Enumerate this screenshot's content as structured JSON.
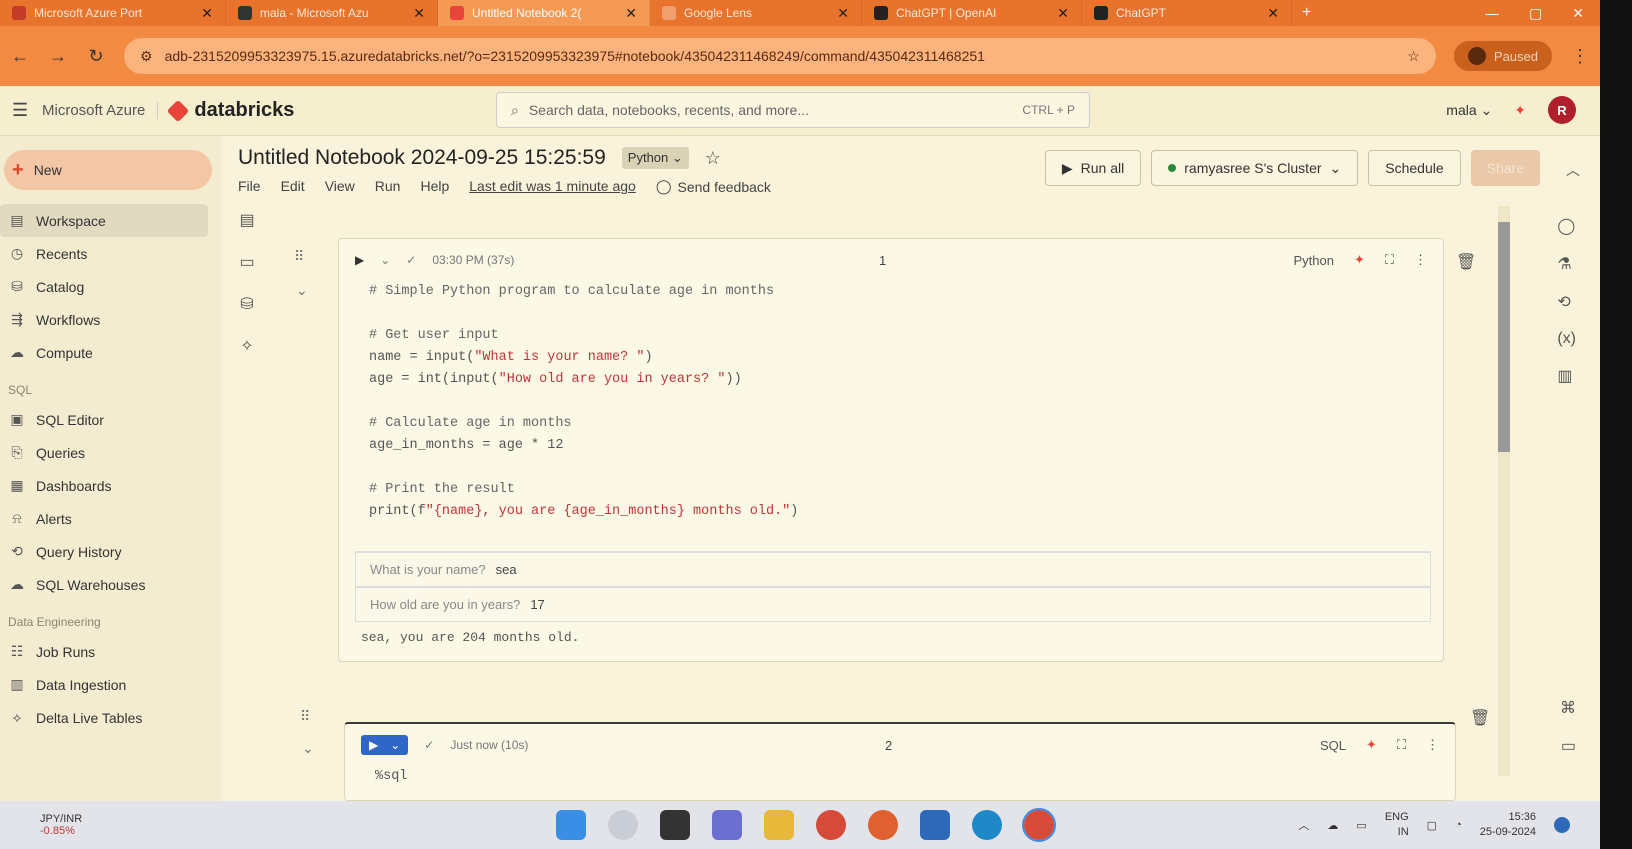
{
  "browser": {
    "tabs": [
      {
        "label": "Microsoft Azure Port",
        "active": false
      },
      {
        "label": "mala - Microsoft Azu",
        "active": false
      },
      {
        "label": "Untitled Notebook 2(",
        "active": true
      },
      {
        "label": "Google Lens",
        "active": false
      },
      {
        "label": "ChatGPT | OpenAI",
        "active": false
      },
      {
        "label": "ChatGPT",
        "active": false
      }
    ],
    "url": "adb-2315209953323975.15.azuredatabricks.net/?o=2315209953323975#notebook/435042311468249/command/435042311468251",
    "paused_label": "Paused"
  },
  "header": {
    "azure_label": "Microsoft Azure",
    "brand": "databricks",
    "search_placeholder": "Search data, notebooks, recents, and more...",
    "search_shortcut": "CTRL + P",
    "user_menu": "mala",
    "avatar_initial": "R"
  },
  "sidebar": {
    "new_label": "New",
    "items": [
      {
        "label": "Workspace",
        "icon": "folder-icon"
      },
      {
        "label": "Recents",
        "icon": "clock-icon"
      },
      {
        "label": "Catalog",
        "icon": "catalog-icon"
      },
      {
        "label": "Workflows",
        "icon": "workflow-icon"
      },
      {
        "label": "Compute",
        "icon": "cloud-icon"
      }
    ],
    "sql_section": "SQL",
    "sql_items": [
      {
        "label": "SQL Editor"
      },
      {
        "label": "Queries"
      },
      {
        "label": "Dashboards"
      },
      {
        "label": "Alerts"
      },
      {
        "label": "Query History"
      },
      {
        "label": "SQL Warehouses"
      }
    ],
    "de_section": "Data Engineering",
    "de_items": [
      {
        "label": "Job Runs"
      },
      {
        "label": "Data Ingestion"
      },
      {
        "label": "Delta Live Tables"
      }
    ]
  },
  "notebook": {
    "title": "Untitled Notebook 2024-09-25 15:25:59",
    "language": "Python",
    "menu": [
      "File",
      "Edit",
      "View",
      "Run",
      "Help"
    ],
    "last_edit": "Last edit was 1 minute ago",
    "feedback": "Send feedback",
    "run_all": "Run all",
    "cluster": "ramyasree S's Cluster",
    "schedule": "Schedule",
    "share": "Share"
  },
  "cell1": {
    "status": "03:30 PM (37s)",
    "index": "1",
    "language": "Python",
    "code": [
      "# Simple Python program to calculate age in months",
      "",
      "# Get user input",
      "name = input(\"What is your name? \")",
      "age = int(input(\"How old are you in years? \"))",
      "",
      "# Calculate age in months",
      "age_in_months = age * 12",
      "",
      "# Print the result",
      "print(f\"{name}, you are {age_in_months} months old.\")"
    ],
    "prompt1_label": "What is your name?",
    "prompt1_value": "sea",
    "prompt2_label": "How old are you in years?",
    "prompt2_value": "17",
    "output": "sea, you are 204 months old."
  },
  "cell2": {
    "status": "Just now (10s)",
    "index": "2",
    "language": "SQL",
    "code": "%sql"
  },
  "taskbar": {
    "ticker": "JPY/INR",
    "change": "-0.85%",
    "lang1": "ENG",
    "lang2": "IN",
    "time": "15:36",
    "date": "25-09-2024"
  }
}
